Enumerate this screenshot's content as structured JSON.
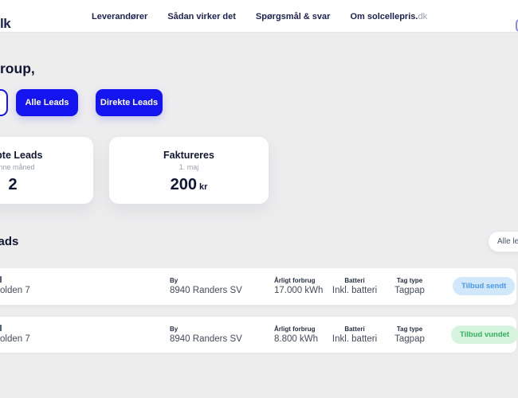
{
  "header": {
    "logo_fragment": "lk",
    "nav": {
      "items": [
        "Leverandører",
        "Sådan virker det",
        "Spørgsmål & svar"
      ],
      "about_prefix": "Om ",
      "about_brand": "solcellepris.",
      "about_suffix": "dk"
    }
  },
  "greeting_fragment": "roup,",
  "filter_buttons": {
    "all": "Alle Leads",
    "direct": "Direkte Leads"
  },
  "stat_cards": [
    {
      "title": "Købte Leads",
      "subtitle": "denne måned",
      "value": "2",
      "unit": ""
    },
    {
      "title": "Faktureres",
      "subtitle": "1. maj",
      "value": "200",
      "unit": "kr"
    }
  ],
  "leads": {
    "section_title": "Leads",
    "filter_dropdown": "Alle leads",
    "columns": {
      "city": "By",
      "consumption": "Årligt forbrug",
      "battery": "Batteri",
      "roof": "Tag type"
    },
    "rows": [
      {
        "address_fragment": "olden 7",
        "city": "8940 Randers SV",
        "consumption": "17.000 kWh",
        "battery": "Inkl. batteri",
        "roof": "Tagpap",
        "status": "Tilbud sendt"
      },
      {
        "address_fragment": "olden 7",
        "city": "8940 Randers SV",
        "consumption": "8.800 kWh",
        "battery": "Inkl. batteri",
        "roof": "Tagpap",
        "status": "Tilbud vundet"
      }
    ]
  },
  "colors": {
    "accent_blue": "#1414f0",
    "navy": "#101734",
    "status_sent_bg": "#d0e7fc",
    "status_sent_text": "#4898f4",
    "status_won_bg": "#d6f3de",
    "status_won_text": "#33b15c"
  }
}
